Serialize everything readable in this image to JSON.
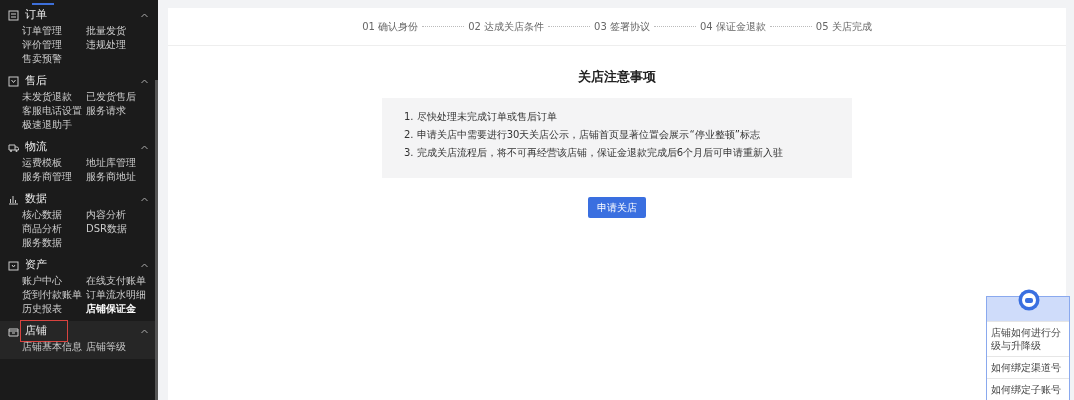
{
  "sidebar": {
    "sections": [
      {
        "title": "订单",
        "expanded": true,
        "highlighted": false,
        "items": [
          {
            "label": "订单管理",
            "selected": false
          },
          {
            "label": "批量发货",
            "selected": false
          },
          {
            "label": "评价管理",
            "selected": false
          },
          {
            "label": "违规处理",
            "selected": false
          },
          {
            "label": "售卖预警",
            "selected": false
          }
        ]
      },
      {
        "title": "售后",
        "expanded": true,
        "highlighted": false,
        "items": [
          {
            "label": "未发货退款",
            "selected": false
          },
          {
            "label": "已发货售后",
            "selected": false
          },
          {
            "label": "客服电话设置",
            "selected": false
          },
          {
            "label": "服务请求",
            "selected": false
          },
          {
            "label": "极速退助手",
            "selected": false
          }
        ]
      },
      {
        "title": "物流",
        "expanded": true,
        "highlighted": false,
        "items": [
          {
            "label": "运费模板",
            "selected": false
          },
          {
            "label": "地址库管理",
            "selected": false
          },
          {
            "label": "服务商管理",
            "selected": false
          },
          {
            "label": "服务商地址",
            "selected": false
          }
        ]
      },
      {
        "title": "数据",
        "expanded": true,
        "highlighted": false,
        "items": [
          {
            "label": "核心数据",
            "selected": false
          },
          {
            "label": "内容分析",
            "selected": false
          },
          {
            "label": "商品分析",
            "selected": false
          },
          {
            "label": "DSR数据",
            "selected": false
          },
          {
            "label": "服务数据",
            "selected": false
          }
        ]
      },
      {
        "title": "资产",
        "expanded": true,
        "highlighted": false,
        "items": [
          {
            "label": "账户中心",
            "selected": false
          },
          {
            "label": "在线支付账单",
            "selected": false
          },
          {
            "label": "货到付款账单",
            "selected": false
          },
          {
            "label": "订单流水明细",
            "selected": false
          },
          {
            "label": "历史报表",
            "selected": false
          },
          {
            "label": "店铺保证金",
            "selected": true
          }
        ]
      },
      {
        "title": "店铺",
        "expanded": true,
        "highlighted": true,
        "items": [
          {
            "label": "店铺基本信息",
            "selected": false
          },
          {
            "label": "店铺等级",
            "selected": false
          }
        ]
      }
    ]
  },
  "steps": [
    "01 确认身份",
    "02 达成关店条件",
    "03 签署协议",
    "04 保证金退款",
    "05 关店完成"
  ],
  "notice": {
    "title": "关店注意事项",
    "items": [
      "1. 尽快处理未完成订单或售后订单",
      "2. 申请关店中需要进行30天关店公示，店铺首页显著位置会展示“停业整顿”标志",
      "3. 完成关店流程后，将不可再经营该店铺，保证金退款完成后6个月后可申请重新入驻"
    ]
  },
  "apply_button": "申请关店",
  "help_widget": {
    "questions": [
      "店铺如何进行分级与升降级",
      "如何绑定渠道号",
      "如何绑定子账号"
    ]
  }
}
